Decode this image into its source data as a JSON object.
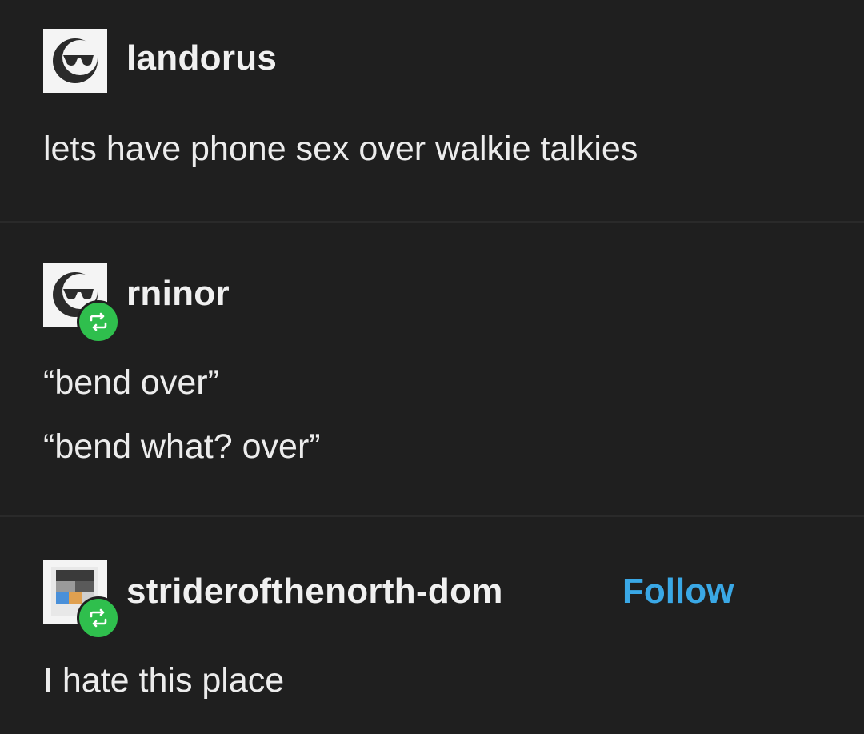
{
  "posts": [
    {
      "username": "landorus",
      "lines": [
        "lets have phone sex over walkie talkies"
      ],
      "avatar_icon": "sunglasses-face-icon",
      "reblog": false
    },
    {
      "username": "rninor",
      "lines": [
        "“bend over”",
        "“bend what? over”"
      ],
      "avatar_icon": "sunglasses-face-icon",
      "reblog": true
    },
    {
      "username": "striderofthenorth-dom",
      "follow_label": "Follow",
      "lines": [
        "I hate this place"
      ],
      "avatar_icon": "pixel-art-icon",
      "reblog": true
    }
  ],
  "colors": {
    "background": "#1f1f1f",
    "text": "#ececec",
    "follow": "#3aa8e6",
    "reblog_badge": "#2fbf4d"
  }
}
